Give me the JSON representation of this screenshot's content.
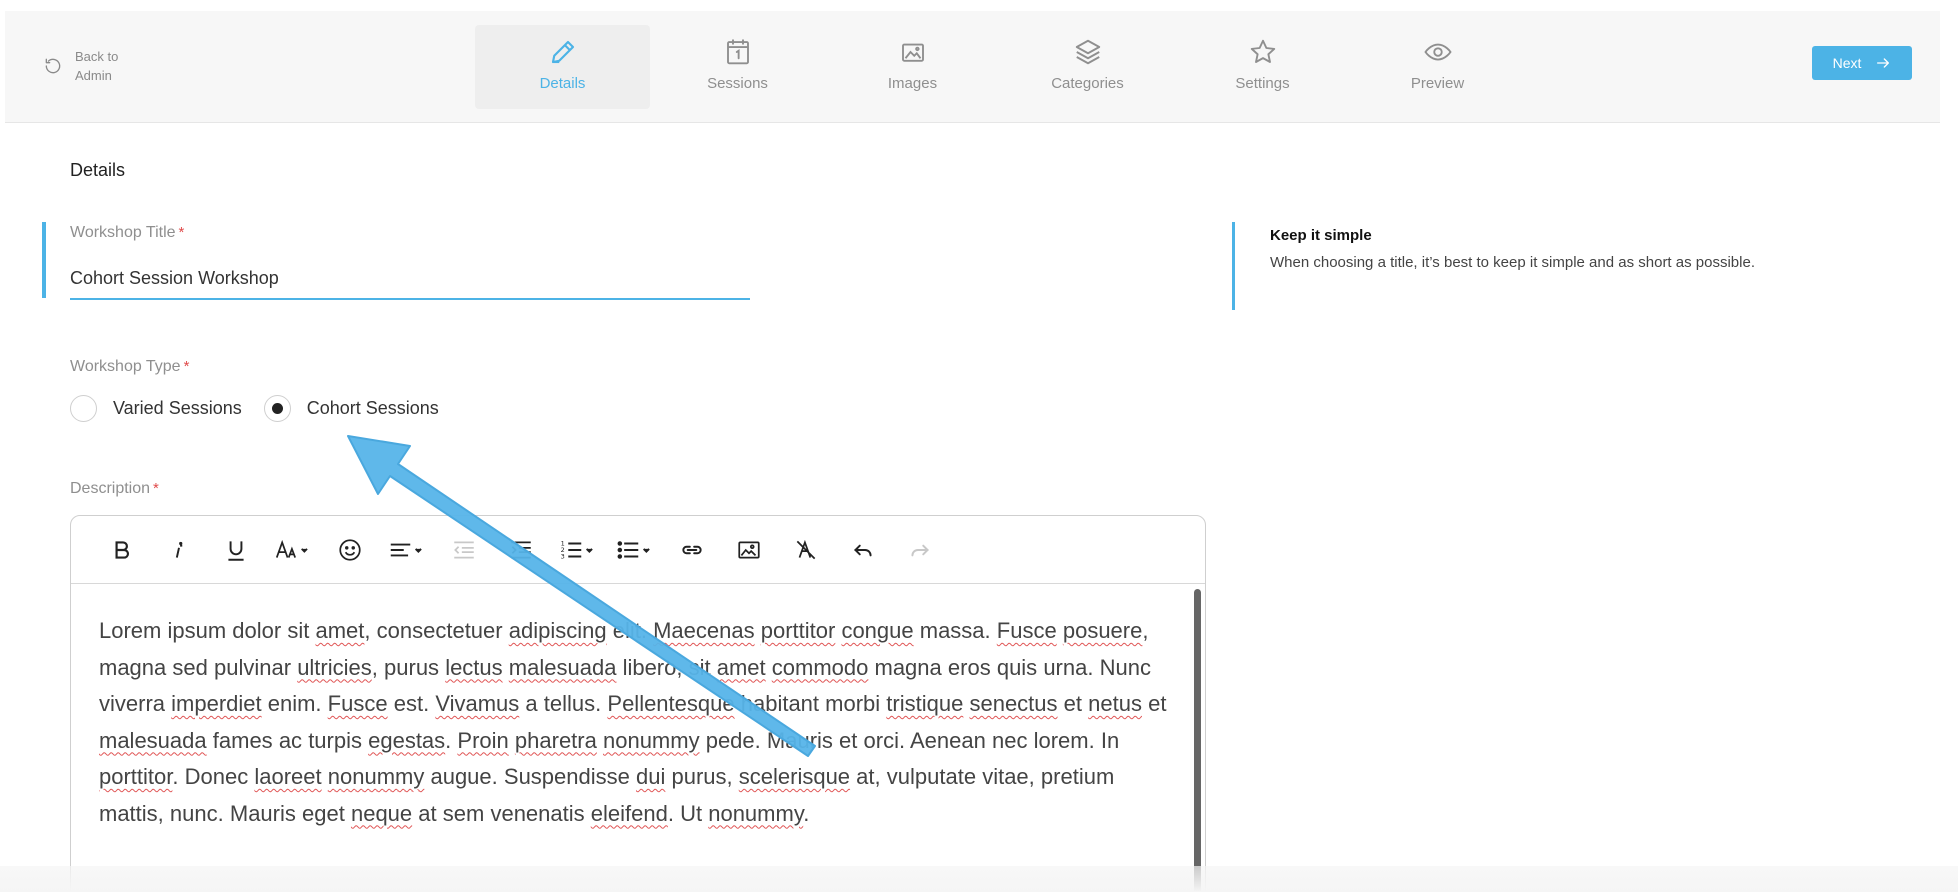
{
  "header": {
    "back_label": "Back to Admin",
    "tabs": [
      {
        "label": "Details",
        "icon": "pencil-icon",
        "active": true
      },
      {
        "label": "Sessions",
        "icon": "calendar-icon",
        "active": false
      },
      {
        "label": "Images",
        "icon": "image-icon",
        "active": false
      },
      {
        "label": "Categories",
        "icon": "layers-icon",
        "active": false
      },
      {
        "label": "Settings",
        "icon": "star-icon",
        "active": false
      },
      {
        "label": "Preview",
        "icon": "eye-icon",
        "active": false
      }
    ],
    "next_label": "Next"
  },
  "main": {
    "section_title": "Details",
    "workshop_title": {
      "label": "Workshop Title",
      "required": "*",
      "value": "Cohort Session Workshop"
    },
    "workshop_type": {
      "label": "Workshop Type",
      "required": "*",
      "options": [
        {
          "label": "Varied Sessions",
          "selected": false
        },
        {
          "label": "Cohort Sessions",
          "selected": true
        }
      ]
    },
    "description": {
      "label": "Description",
      "required": "*",
      "text": "Lorem ipsum dolor sit amet, consectetuer adipiscing elit. Maecenas porttitor congue massa. Fusce posuere, magna sed pulvinar ultricies, purus lectus malesuada libero, sit amet commodo magna eros quis urna. Nunc viverra imperdiet enim. Fusce est. Vivamus a tellus. Pellentesque habitant morbi tristique senectus et netus et malesuada fames ac turpis egestas. Proin pharetra nonummy pede. Mauris et orci. Aenean nec lorem. In porttitor. Donec laoreet nonummy augue. Suspendisse dui purus, scelerisque at, vulputate vitae, pretium mattis, nunc. Mauris eget neque at sem venenatis eleifend. Ut nonummy."
    }
  },
  "hint": {
    "title": "Keep it simple",
    "text": "When choosing a title, it’s best to keep it simple and as short as possible."
  },
  "colors": {
    "accent": "#4cb3e6",
    "required": "#e04a4a",
    "annotation_arrow": "#56b4e9"
  }
}
